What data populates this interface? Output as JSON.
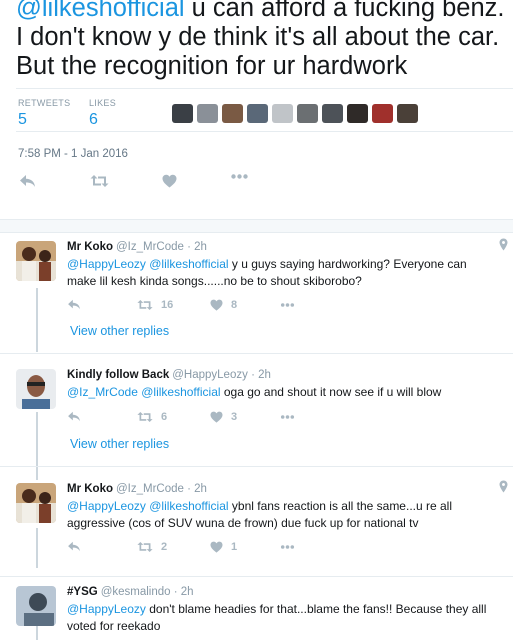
{
  "main_tweet": {
    "mention": "@lilkeshofficial",
    "line1_rest": " u can afford a fucking benz.",
    "line2": "I don't know y de think it's all about the car.",
    "line3": "But the recognition for ur hardwork",
    "retweets_label": "RETWEETS",
    "retweets_count": "5",
    "likes_label": "LIKES",
    "likes_count": "6",
    "timestamp": "7:58 PM - 1 Jan 2016"
  },
  "liker_avatars": [
    "#3a3f45",
    "#8a9098",
    "#7a5a44",
    "#5a6878",
    "#c0c4c8",
    "#6b6f72",
    "#4d5258",
    "#2f2a28",
    "#a0302c",
    "#4a4038"
  ],
  "replies": [
    {
      "name": "Mr Koko",
      "handle": "@Iz_MrCode",
      "time": "· 2h",
      "mention1": "@HappyLeozy",
      "mention2": "@lilkeshofficial",
      "text1": " y u guys saying hardworking? Everyone can",
      "text2": "make lil kesh kinda songs......no be to shout skiborobo?",
      "retweets": "16",
      "likes": "8",
      "view_replies": "View other replies",
      "avatar_color": "#7b3f2a"
    },
    {
      "name": "Kindly follow Back",
      "handle": "@HappyLeozy",
      "time": "· 2h",
      "mention1": "@Iz_MrCode",
      "mention2": "@lilkeshofficial",
      "text1": " oga go and shout it now see if u will blow",
      "retweets": "6",
      "likes": "3",
      "view_replies": "View other replies",
      "avatar_color": "#8a6a5a"
    },
    {
      "name": "Mr Koko",
      "handle": "@Iz_MrCode",
      "time": "· 2h",
      "mention1": "@HappyLeozy",
      "mention2": "@lilkeshofficial",
      "text1": " ybnl fans reaction is all the same...u re all",
      "text2": "aggressive (cos of SUV wuna de frown) due fuck up for national tv",
      "retweets": "2",
      "likes": "1",
      "avatar_color": "#7b3f2a"
    },
    {
      "name": "#YSG",
      "handle": "@kesmalindo",
      "time": "· 2h",
      "mention1": "@HappyLeozy",
      "text1": " don't blame headies for that...blame the fans!! Because they alll",
      "text2": "voted for reekado",
      "avatar_color": "#5c6f82"
    }
  ]
}
